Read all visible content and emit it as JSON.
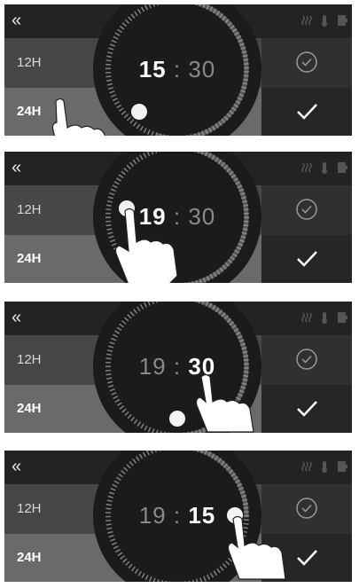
{
  "back_label": "«",
  "status_icons": [
    "heat-icon",
    "temperature-icon",
    "door-icon"
  ],
  "format_options": [
    {
      "label": "12H"
    },
    {
      "label": "24H"
    }
  ],
  "panels": [
    {
      "hour": "15",
      "sep": ":",
      "minute": "30",
      "active": "hour"
    },
    {
      "hour": "19",
      "sep": ":",
      "minute": "30",
      "active": "hour"
    },
    {
      "hour": "19",
      "sep": ":",
      "minute": "30",
      "active": "minute"
    },
    {
      "hour": "19",
      "sep": ":",
      "minute": "15",
      "active": "minute"
    }
  ],
  "colors": {
    "topbar": "#232323",
    "dial": "#1b1b1b",
    "row_selected": "#6a6a6a",
    "accent": "#ffffff"
  }
}
